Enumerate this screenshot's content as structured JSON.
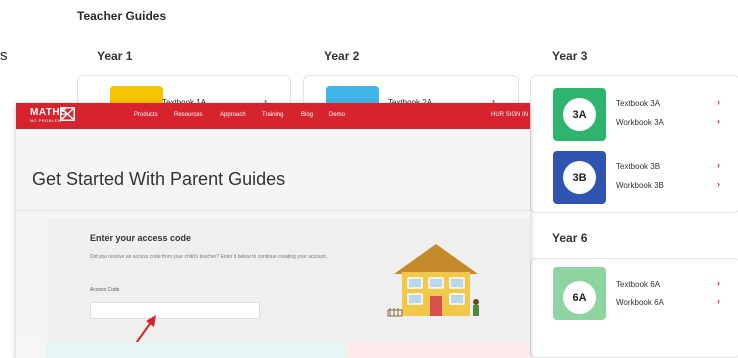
{
  "background": {
    "title": "Teacher Guides",
    "left_edge_char": "s",
    "years": [
      {
        "label": "Year 1",
        "books": [
          {
            "code": "",
            "color": "#f6c400",
            "links": [
              {
                "label": "Textbook 1A"
              }
            ]
          }
        ]
      },
      {
        "label": "Year 2",
        "books": [
          {
            "code": "",
            "color": "#3fb6e6",
            "links": [
              {
                "label": "Textbook 2A"
              }
            ]
          }
        ]
      },
      {
        "label": "Year 3",
        "books": [
          {
            "code": "3A",
            "color": "#2fb46f",
            "links": [
              {
                "label": "Textbook 3A"
              },
              {
                "label": "Workbook 3A"
              }
            ]
          },
          {
            "code": "3B",
            "color": "#2f55b0",
            "links": [
              {
                "label": "Textbook 3B"
              },
              {
                "label": "Workbook 3B"
              }
            ]
          }
        ]
      },
      {
        "label": "Year 6",
        "books": [
          {
            "code": "6A",
            "color": "#8dd4a0",
            "links": [
              {
                "label": "Textbook 6A"
              },
              {
                "label": "Workbook 6A"
              }
            ]
          }
        ]
      }
    ],
    "chevron": "›",
    "accent_color": "#d9282f"
  },
  "overlay": {
    "nav": {
      "logo": "MATHS",
      "logo_sub": "NO PROBLEM",
      "items": [
        "Products",
        "Resources",
        "Approach",
        "Training",
        "Blog",
        "Demo"
      ],
      "account": "HUR SIGN IN",
      "bar_color": "#d6232d"
    },
    "heading": "Get Started With Parent Guides",
    "access": {
      "title": "Enter your access code",
      "description": "Did you receive an access code from your child's teacher? Enter it below to continue creating your account.",
      "field_label": "Access Code",
      "input_value": "",
      "input_placeholder": ""
    }
  }
}
